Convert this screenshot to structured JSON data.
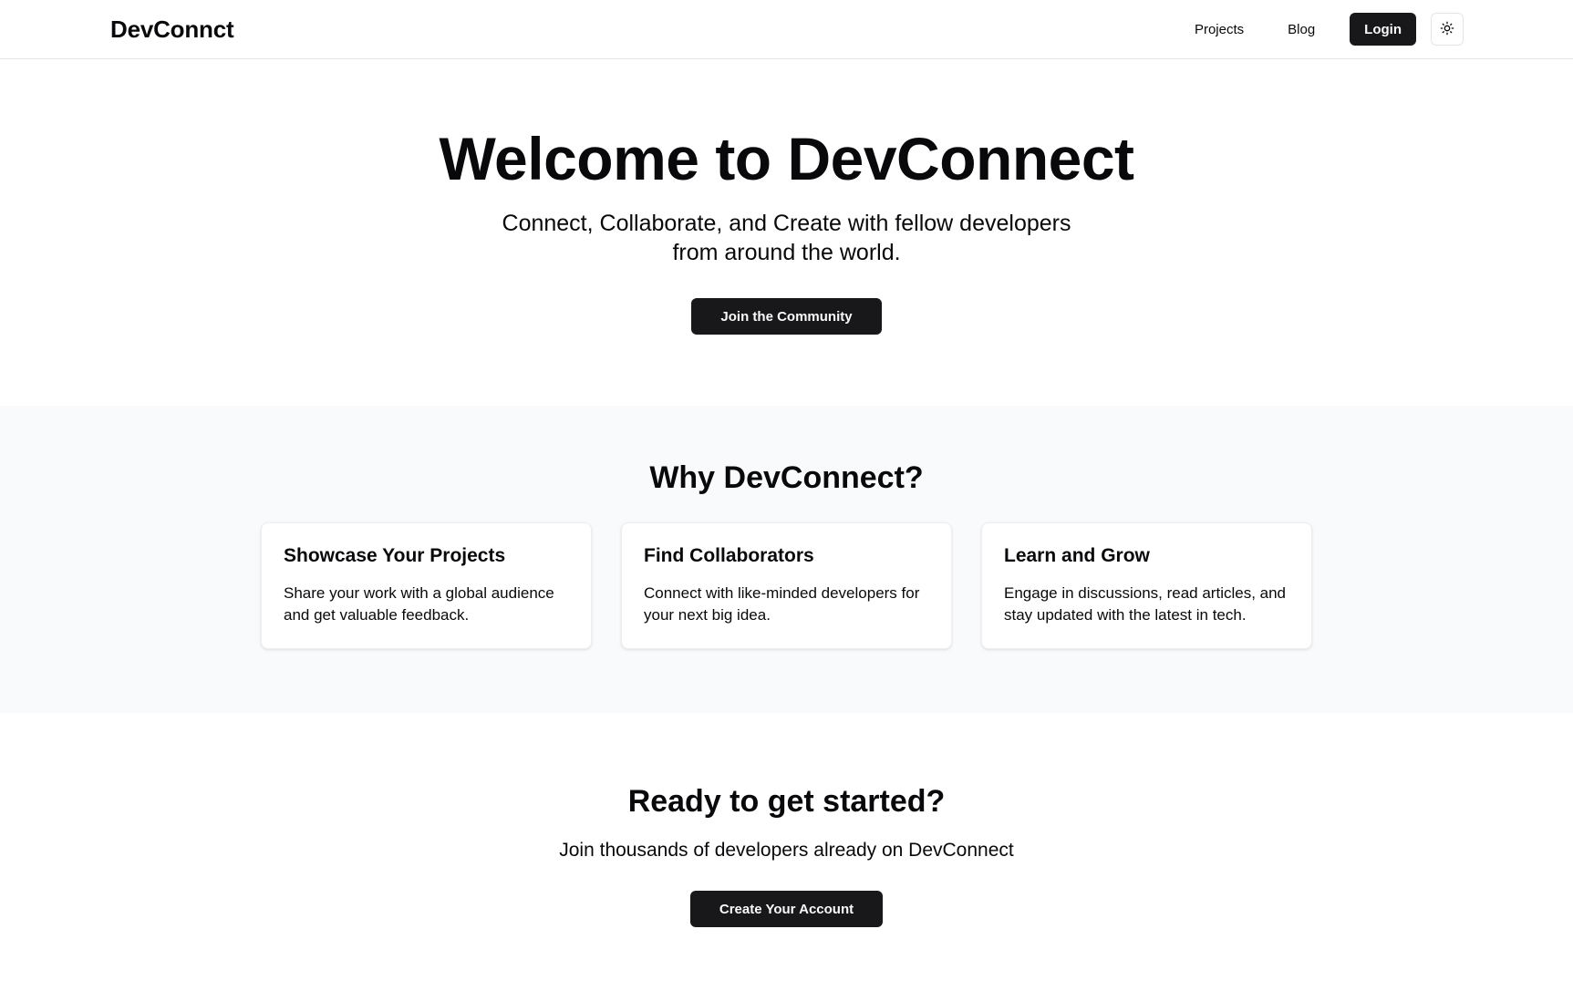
{
  "header": {
    "brand": "DevConnct",
    "nav": [
      "Projects",
      "Blog"
    ],
    "login_label": "Login",
    "theme_icon": "sun-icon"
  },
  "hero": {
    "title": "Welcome to DevConnect",
    "subtitle": "Connect, Collaborate, and Create with fellow developers from around the world.",
    "button_label": "Join the Community"
  },
  "features": {
    "title": "Why DevConnect?",
    "cards": [
      {
        "title": "Showcase Your Projects",
        "description": "Share your work with a global audience and get valuable feedback."
      },
      {
        "title": "Find Collaborators",
        "description": "Connect with like-minded developers for your next big idea."
      },
      {
        "title": "Learn and Grow",
        "description": "Engage in discussions, read articles, and stay updated with the latest in tech."
      }
    ]
  },
  "cta": {
    "title": "Ready to get started?",
    "subtitle": "Join thousands of developers already on DevConnect",
    "button_label": "Create Your Account"
  },
  "colors": {
    "primary": "#18181b",
    "section_bg": "#f9fafb",
    "border": "#e4e4e7"
  }
}
